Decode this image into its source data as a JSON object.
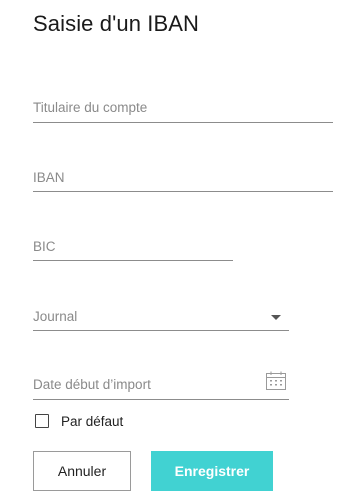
{
  "form": {
    "title": "Saisie d'un IBAN",
    "fields": {
      "titulaire": {
        "placeholder": "Titulaire du compte",
        "value": ""
      },
      "iban": {
        "placeholder": "IBAN",
        "value": ""
      },
      "bic": {
        "placeholder": "BIC",
        "value": ""
      },
      "journal": {
        "placeholder": "Journal",
        "value": ""
      },
      "date_import": {
        "placeholder": "Date début d’import",
        "value": ""
      }
    },
    "default_checkbox": {
      "label": "Par défaut",
      "checked": false
    },
    "buttons": {
      "cancel": "Annuler",
      "save": "Enregistrer"
    }
  },
  "icons": {
    "journal_dropdown": "caret-down-icon",
    "date_picker": "calendar-icon",
    "default": "checkbox-icon"
  },
  "colors": {
    "accent": "#41d2d2",
    "text": "#1a1a1a",
    "placeholder": "#8a8a8a",
    "underline": "#8c8c8c"
  }
}
